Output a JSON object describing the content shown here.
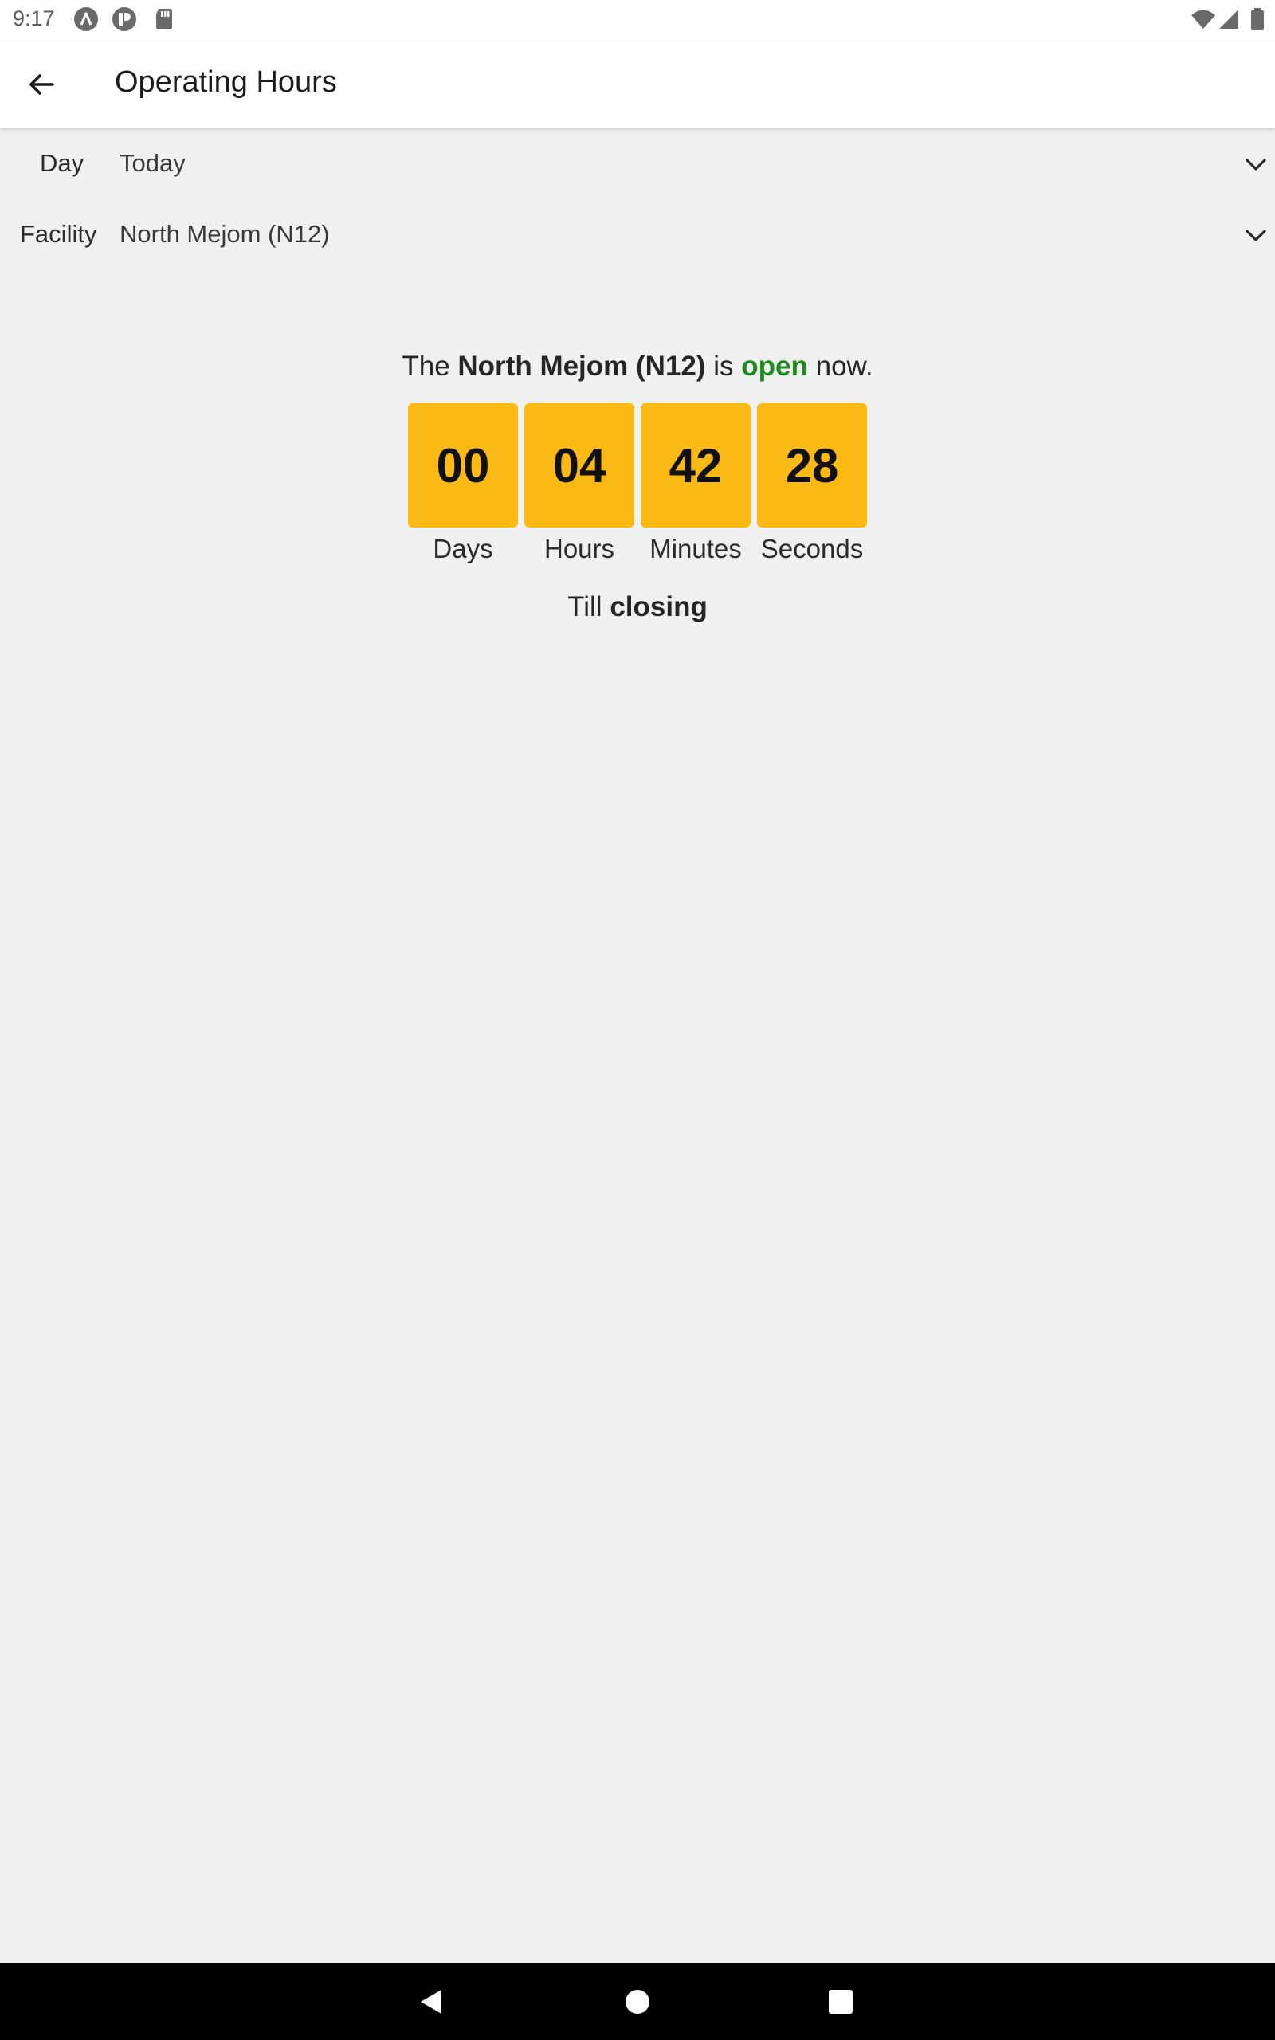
{
  "status_bar": {
    "time": "9:17",
    "icons": [
      "app-a-icon",
      "app-p-icon",
      "sd-card-icon",
      "wifi-icon",
      "cell-signal-icon",
      "battery-icon"
    ]
  },
  "app_bar": {
    "title": "Operating Hours",
    "back_icon": "arrow-back-icon"
  },
  "filters": {
    "day": {
      "label": "Day",
      "value": "Today"
    },
    "facility": {
      "label": "Facility",
      "value": "North Mejom (N12)"
    }
  },
  "status": {
    "prefix": "The",
    "facility_name": "North Mejom (N12)",
    "is_word": "is",
    "state": "open",
    "suffix": "now.",
    "state_color": "#1f8a1f"
  },
  "countdown": {
    "units": [
      {
        "value": "00",
        "label": "Days"
      },
      {
        "value": "04",
        "label": "Hours"
      },
      {
        "value": "42",
        "label": "Minutes"
      },
      {
        "value": "28",
        "label": "Seconds"
      }
    ],
    "box_color": "#fbb915",
    "till_prefix": "Till",
    "till_event": "closing"
  },
  "nav_bar": {
    "icons": [
      "nav-back-icon",
      "nav-home-icon",
      "nav-recents-icon"
    ]
  }
}
